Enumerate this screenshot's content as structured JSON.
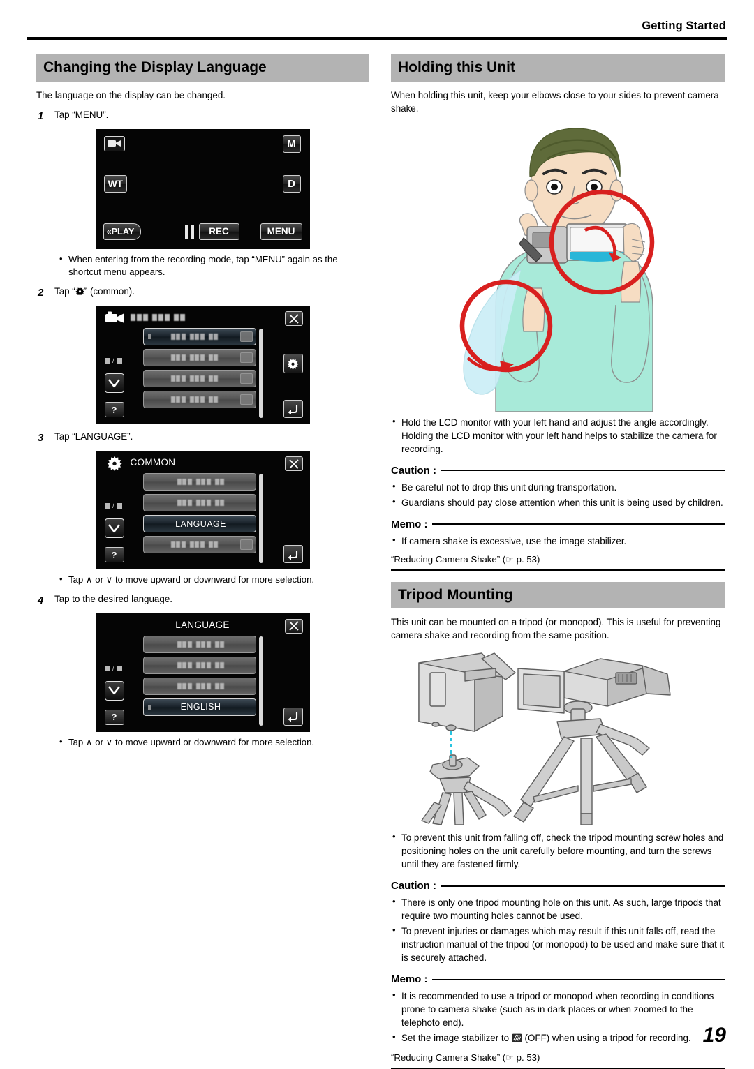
{
  "header": {
    "running_head": "Getting Started"
  },
  "page_number": "19",
  "left": {
    "section1": {
      "title": "Changing the Display Language",
      "intro": "The language on the display can be changed.",
      "steps": [
        {
          "num": "1",
          "text": "Tap “MENU”."
        },
        {
          "num": "2",
          "text_before": "Tap “",
          "text_after": "” (common)."
        },
        {
          "num": "3",
          "text": "Tap “LANGUAGE”."
        },
        {
          "num": "4",
          "text": "Tap to the desired language."
        }
      ],
      "note_after_step1": "When entering from the recording mode, tap “MENU” again as the shortcut menu appears.",
      "note_after_step3": "Tap ∧ or ∨ to move upward or downward for more selection.",
      "note_after_step4": "Tap ∧ or ∨ to move upward or downward for more selection."
    },
    "screens": {
      "rec": {
        "name": "recording-screen",
        "camera_icon": "video-camera-icon",
        "m_label": "M",
        "wt_label": "WT",
        "d_label": "D",
        "play_label": "«PLAY",
        "rec_label": "REC",
        "menu_label": "MENU",
        "pause_icon": "pause-icon"
      },
      "menu_common": {
        "name": "main-menu-screen",
        "title": "",
        "page_indicator": "1/3",
        "close_label": "close-icon",
        "gear_label": "gear-icon",
        "back_label": "back-icon",
        "help_label": "?",
        "down_label": "chevron-down-icon",
        "rows": [
          {
            "label": "",
            "selected": true,
            "thumb": true
          },
          {
            "label": "",
            "selected": false,
            "thumb": true
          },
          {
            "label": "",
            "selected": false,
            "thumb": true
          },
          {
            "label": "",
            "selected": false,
            "thumb": true
          }
        ]
      },
      "common_screen": {
        "name": "common-settings-screen",
        "title": "COMMON",
        "page_indicator": "1/3",
        "help_label": "?",
        "rows": [
          {
            "label": "",
            "selected": false,
            "thumb": false
          },
          {
            "label": "",
            "selected": false,
            "thumb": false
          },
          {
            "label": "LANGUAGE",
            "selected": true,
            "thumb": false
          },
          {
            "label": "",
            "selected": false,
            "thumb": true
          }
        ]
      },
      "language_screen": {
        "name": "language-select-screen",
        "title": "LANGUAGE",
        "page_indicator": "1/3",
        "help_label": "?",
        "rows": [
          {
            "label": "",
            "selected": false,
            "thumb": false
          },
          {
            "label": "",
            "selected": false,
            "thumb": false
          },
          {
            "label": "",
            "selected": false,
            "thumb": false
          },
          {
            "label": "ENGLISH",
            "selected": true,
            "thumb": false
          }
        ]
      }
    }
  },
  "right": {
    "section_holding": {
      "title": "Holding this Unit",
      "intro": "When holding this unit, keep your elbows close to your sides to prevent camera shake.",
      "bullets": [
        "Hold the LCD monitor with your left hand and adjust the angle accordingly. Holding the LCD monitor with your left hand helps to stabilize the camera for recording."
      ],
      "caution_label": "Caution :",
      "caution_bullets": [
        "Be careful not to drop this unit during transportation.",
        "Guardians should pay close attention when this unit is being used by children."
      ],
      "memo_label": "Memo :",
      "memo_bullets": [
        "If camera shake is excessive, use the image stabilizer."
      ],
      "memo_ref": "“Reducing Camera Shake” (☞ p. 53)"
    },
    "section_tripod": {
      "title": "Tripod Mounting",
      "intro": "This unit can be mounted on a tripod (or monopod). This is useful for preventing camera shake and recording from the same position.",
      "bullets": [
        "To prevent this unit from falling off, check the tripod mounting screw holes and positioning holes on the unit carefully before mounting, and turn the screws until they are fastened firmly."
      ],
      "caution_label": "Caution :",
      "caution_bullets": [
        "There is only one tripod mounting hole on this unit. As such, large tripods that require two mounting holes cannot be used.",
        "To prevent injuries or damages which may result if this unit falls off, read the instruction manual of the tripod (or monopod) to be used and make sure that it is securely attached."
      ],
      "memo_label": "Memo :",
      "memo_bullets_pre": "It is recommended to use a tripod or monopod when recording in conditions prone to camera shake (such as in dark places or when zoomed to the telephoto end).",
      "memo_bullet_stab_pre": "Set the image stabilizer to ",
      "memo_bullet_stab_post": " (OFF) when using a tripod for recording.",
      "memo_ref": "“Reducing Camera Shake” (☞ p. 53)"
    },
    "illustrations": {
      "person": "person-holding-camcorder-illustration",
      "tripod": "camcorder-tripod-mounting-illustration"
    }
  },
  "colors": {
    "section_bar": "#b3b3b3",
    "accent_red": "#d8201f",
    "shirt": "#a8ead9",
    "skin": "#f6ddc3",
    "hair": "#5f6b3a",
    "lcd_blue": "#29b6d8"
  }
}
